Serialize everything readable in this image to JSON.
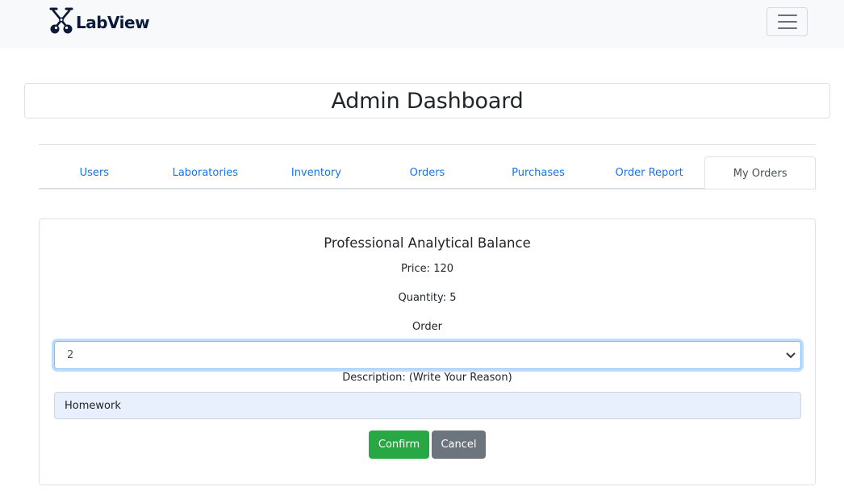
{
  "navbar": {
    "brand": "LabView",
    "logo_icon": "flask-cross-icon",
    "toggler_icon": "hamburger-icon"
  },
  "header": {
    "title": "Admin Dashboard"
  },
  "tabs": [
    {
      "label": "Users",
      "active": false
    },
    {
      "label": "Laboratories",
      "active": false
    },
    {
      "label": "Inventory",
      "active": false
    },
    {
      "label": "Orders",
      "active": false
    },
    {
      "label": "Purchases",
      "active": false
    },
    {
      "label": "Order Report",
      "active": false
    },
    {
      "label": "My Orders",
      "active": true
    }
  ],
  "product": {
    "name": "Professional Analytical Balance",
    "price_text": "Price: 120",
    "quantity_text": "Quantity: 5",
    "order_label": "Order",
    "order_value": "2",
    "description_label": "Description: (Write Your Reason)",
    "description_value": "Homework"
  },
  "actions": {
    "confirm_label": "Confirm",
    "cancel_label": "Cancel"
  },
  "colors": {
    "link": "#1a73e8",
    "confirm": "#28a745",
    "cancel": "#6c757d",
    "navbar_bg": "#f8f9fa",
    "brand": "#0b1a3a"
  }
}
